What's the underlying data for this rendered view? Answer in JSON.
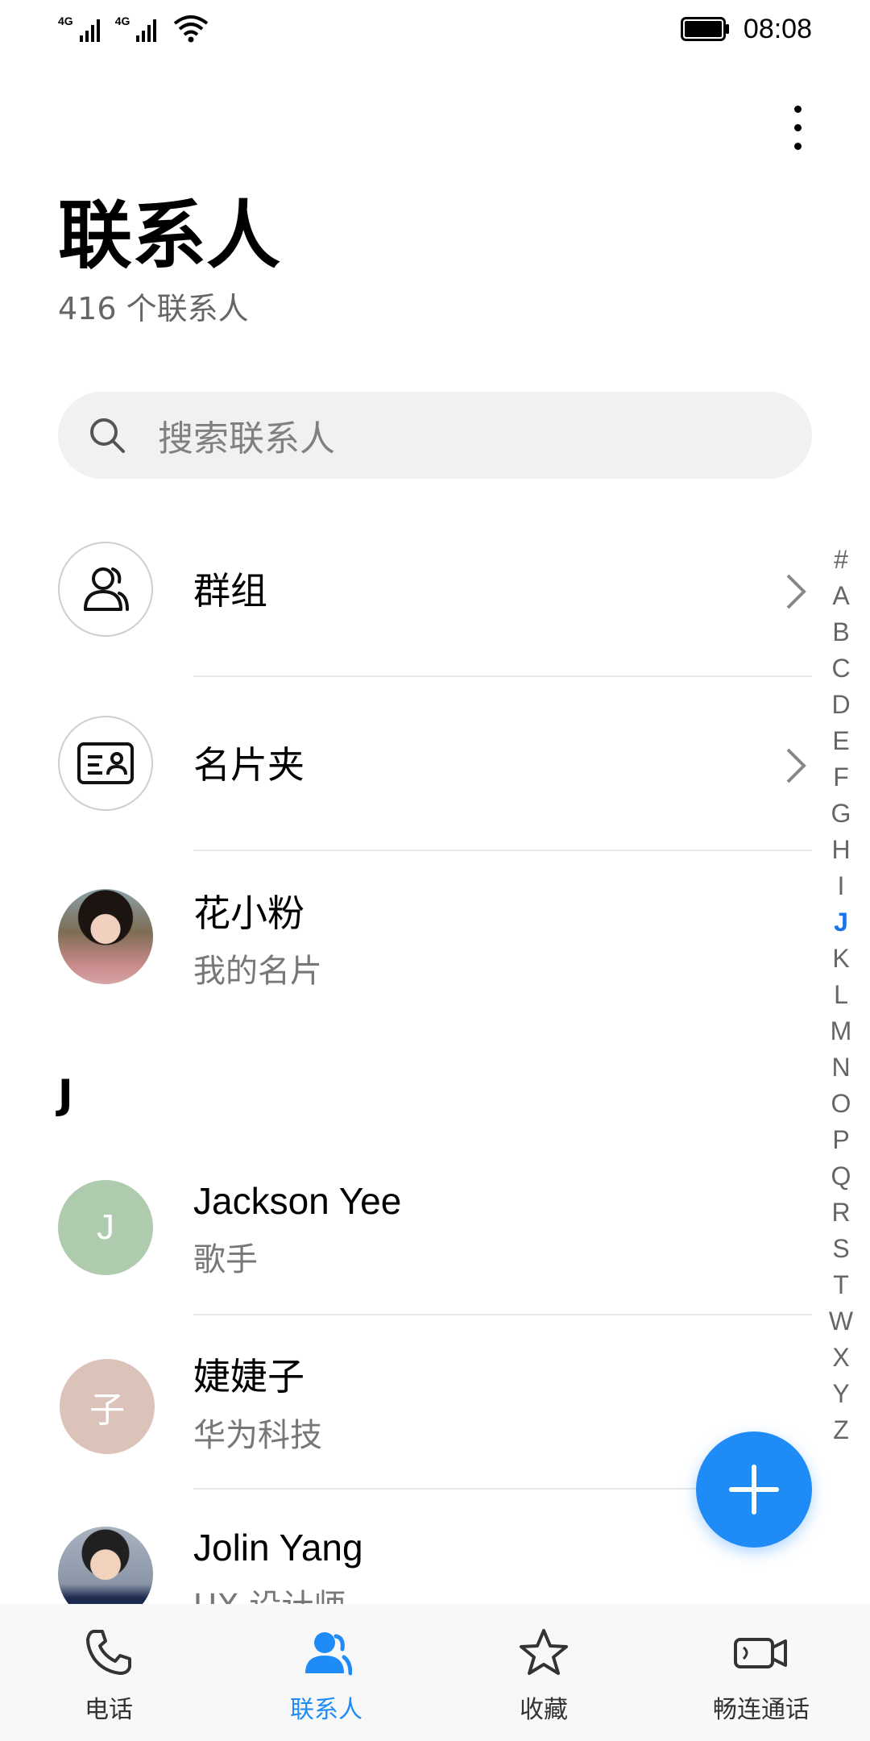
{
  "status_bar": {
    "network1": "4G",
    "network2": "4G",
    "time": "08:08"
  },
  "header": {
    "title": "联系人",
    "subtitle": "416 个联系人"
  },
  "search": {
    "placeholder": "搜索联系人"
  },
  "quick_items": [
    {
      "label": "群组",
      "icon": "group-icon"
    },
    {
      "label": "名片夹",
      "icon": "business-card-icon"
    }
  ],
  "my_card": {
    "name": "花小粉",
    "subtitle": "我的名片"
  },
  "section_letter": "J",
  "contacts": [
    {
      "name": "Jackson Yee",
      "subtitle": "歌手",
      "avatar_letter": "J",
      "avatar_color": "#aecbad"
    },
    {
      "name": "婕婕子",
      "subtitle": "华为科技",
      "avatar_letter": "子",
      "avatar_color": "#dcc3ba"
    },
    {
      "name": "Jolin Yang",
      "subtitle": "UX 设计师"
    }
  ],
  "alphabet_index": [
    "#",
    "A",
    "B",
    "C",
    "D",
    "E",
    "F",
    "G",
    "H",
    "I",
    "J",
    "K",
    "L",
    "M",
    "N",
    "O",
    "P",
    "Q",
    "R",
    "S",
    "T",
    "W",
    "X",
    "Y",
    "Z"
  ],
  "active_index": "J",
  "bottom_nav": [
    {
      "label": "电话",
      "icon": "phone-icon"
    },
    {
      "label": "联系人",
      "icon": "contacts-icon",
      "active": true
    },
    {
      "label": "收藏",
      "icon": "star-icon"
    },
    {
      "label": "畅连通话",
      "icon": "video-call-icon"
    }
  ],
  "colors": {
    "accent": "#1f8bf7",
    "index_active": "#1a73e8"
  }
}
